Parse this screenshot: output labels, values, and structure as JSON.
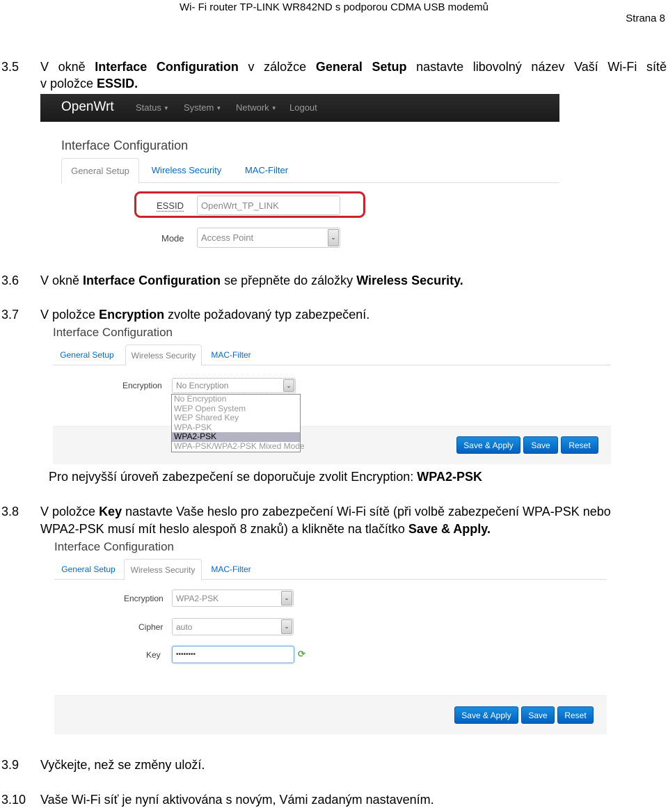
{
  "document": {
    "header": "Wi- Fi router TP-LINK WR842ND s podporou CDMA USB modemů",
    "page": "Strana 8"
  },
  "steps": {
    "s35": {
      "num": "3.5",
      "line1_parts": [
        "V okně ",
        "Interface Configuration",
        " v záložce ",
        "General Setup",
        " nastavte libovolný název Vaší Wi-Fi sítě"
      ],
      "line2_parts": [
        "v položce ",
        "ESSID."
      ]
    },
    "s36": {
      "num": "3.6",
      "parts": [
        "V okně ",
        "Interface Configuration",
        " se přepněte do záložky ",
        "Wireless Security."
      ]
    },
    "s37": {
      "num": "3.7",
      "parts": [
        "V položce ",
        "Encryption",
        " zvolte požadovaný typ zabezpečení."
      ]
    },
    "note": {
      "parts": [
        "Pro nejvyšší úroveň zabezpečení se doporučuje zvolit Encryption: ",
        "WPA2-PSK"
      ]
    },
    "s38": {
      "num": "3.8",
      "line1_parts": [
        "V položce ",
        "Key",
        " nastavte Vaše heslo pro zabezpečení Wi-Fi sítě (při volbě zabezpečení WPA-PSK nebo"
      ],
      "line2_parts": [
        "WPA2-PSK musí mít heslo alespoň 8 znaků) a klikněte na tlačítko ",
        "Save & Apply."
      ]
    },
    "s39": {
      "num": "3.9",
      "text": "Vyčkejte, než se změny uloží."
    },
    "s310": {
      "num": "3.10",
      "text": "Vaše Wi-Fi síť je nyní aktivována s novým, Vámi zadaným nastavením."
    }
  },
  "shot1": {
    "brand": "OpenWrt",
    "nav": [
      {
        "label": "Status",
        "caret": "▼"
      },
      {
        "label": "System",
        "caret": "▼"
      },
      {
        "label": "Network",
        "caret": "▼"
      },
      {
        "label": "Logout"
      }
    ],
    "title": "Interface Configuration",
    "tabs": [
      "General Setup",
      "Wireless Security",
      "MAC-Filter"
    ],
    "active_tab": "General Setup",
    "essid_label": "ESSID",
    "essid_value": "OpenWrt_TP_LINK",
    "mode_label": "Mode",
    "mode_value": "Access Point",
    "highlight_color": "#d0202a"
  },
  "shot2": {
    "title": "Interface Configuration",
    "tabs": [
      "General Setup",
      "Wireless Security",
      "MAC-Filter"
    ],
    "active_tab": "Wireless Security",
    "encryption_label": "Encryption",
    "encryption_value": "No Encryption",
    "options": [
      "No Encryption",
      "WEP Open System",
      "WEP Shared Key",
      "WPA-PSK",
      "WPA2-PSK",
      "WPA-PSK/WPA2-PSK Mixed Mode"
    ],
    "highlighted_option": "WPA2-PSK",
    "buttons": [
      "Save & Apply",
      "Save",
      "Reset"
    ]
  },
  "shot3": {
    "title": "Interface Configuration",
    "tabs": [
      "General Setup",
      "Wireless Security",
      "MAC-Filter"
    ],
    "active_tab": "Wireless Security",
    "encryption_label": "Encryption",
    "encryption_value": "WPA2-PSK",
    "cipher_label": "Cipher",
    "cipher_value": "auto",
    "key_label": "Key",
    "key_value": "••••••••",
    "buttons": [
      "Save & Apply",
      "Save",
      "Reset"
    ]
  },
  "icons": {
    "caret": "▼",
    "select_arrow": "⌄",
    "refresh": "⟳"
  },
  "colors": {
    "button_blue": "#0a74d4",
    "tab_link": "#0069d6",
    "navbar": "#222222"
  }
}
